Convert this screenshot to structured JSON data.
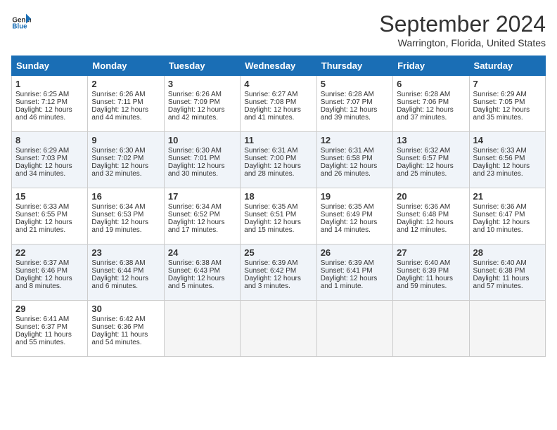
{
  "header": {
    "logo_line1": "General",
    "logo_line2": "Blue",
    "month": "September 2024",
    "location": "Warrington, Florida, United States"
  },
  "days_of_week": [
    "Sunday",
    "Monday",
    "Tuesday",
    "Wednesday",
    "Thursday",
    "Friday",
    "Saturday"
  ],
  "weeks": [
    [
      {
        "num": "1",
        "sunrise": "6:25 AM",
        "sunset": "7:12 PM",
        "daylight": "12 hours and 46 minutes."
      },
      {
        "num": "2",
        "sunrise": "6:26 AM",
        "sunset": "7:11 PM",
        "daylight": "12 hours and 44 minutes."
      },
      {
        "num": "3",
        "sunrise": "6:26 AM",
        "sunset": "7:09 PM",
        "daylight": "12 hours and 42 minutes."
      },
      {
        "num": "4",
        "sunrise": "6:27 AM",
        "sunset": "7:08 PM",
        "daylight": "12 hours and 41 minutes."
      },
      {
        "num": "5",
        "sunrise": "6:28 AM",
        "sunset": "7:07 PM",
        "daylight": "12 hours and 39 minutes."
      },
      {
        "num": "6",
        "sunrise": "6:28 AM",
        "sunset": "7:06 PM",
        "daylight": "12 hours and 37 minutes."
      },
      {
        "num": "7",
        "sunrise": "6:29 AM",
        "sunset": "7:05 PM",
        "daylight": "12 hours and 35 minutes."
      }
    ],
    [
      {
        "num": "8",
        "sunrise": "6:29 AM",
        "sunset": "7:03 PM",
        "daylight": "12 hours and 34 minutes."
      },
      {
        "num": "9",
        "sunrise": "6:30 AM",
        "sunset": "7:02 PM",
        "daylight": "12 hours and 32 minutes."
      },
      {
        "num": "10",
        "sunrise": "6:30 AM",
        "sunset": "7:01 PM",
        "daylight": "12 hours and 30 minutes."
      },
      {
        "num": "11",
        "sunrise": "6:31 AM",
        "sunset": "7:00 PM",
        "daylight": "12 hours and 28 minutes."
      },
      {
        "num": "12",
        "sunrise": "6:31 AM",
        "sunset": "6:58 PM",
        "daylight": "12 hours and 26 minutes."
      },
      {
        "num": "13",
        "sunrise": "6:32 AM",
        "sunset": "6:57 PM",
        "daylight": "12 hours and 25 minutes."
      },
      {
        "num": "14",
        "sunrise": "6:33 AM",
        "sunset": "6:56 PM",
        "daylight": "12 hours and 23 minutes."
      }
    ],
    [
      {
        "num": "15",
        "sunrise": "6:33 AM",
        "sunset": "6:55 PM",
        "daylight": "12 hours and 21 minutes."
      },
      {
        "num": "16",
        "sunrise": "6:34 AM",
        "sunset": "6:53 PM",
        "daylight": "12 hours and 19 minutes."
      },
      {
        "num": "17",
        "sunrise": "6:34 AM",
        "sunset": "6:52 PM",
        "daylight": "12 hours and 17 minutes."
      },
      {
        "num": "18",
        "sunrise": "6:35 AM",
        "sunset": "6:51 PM",
        "daylight": "12 hours and 15 minutes."
      },
      {
        "num": "19",
        "sunrise": "6:35 AM",
        "sunset": "6:49 PM",
        "daylight": "12 hours and 14 minutes."
      },
      {
        "num": "20",
        "sunrise": "6:36 AM",
        "sunset": "6:48 PM",
        "daylight": "12 hours and 12 minutes."
      },
      {
        "num": "21",
        "sunrise": "6:36 AM",
        "sunset": "6:47 PM",
        "daylight": "12 hours and 10 minutes."
      }
    ],
    [
      {
        "num": "22",
        "sunrise": "6:37 AM",
        "sunset": "6:46 PM",
        "daylight": "12 hours and 8 minutes."
      },
      {
        "num": "23",
        "sunrise": "6:38 AM",
        "sunset": "6:44 PM",
        "daylight": "12 hours and 6 minutes."
      },
      {
        "num": "24",
        "sunrise": "6:38 AM",
        "sunset": "6:43 PM",
        "daylight": "12 hours and 5 minutes."
      },
      {
        "num": "25",
        "sunrise": "6:39 AM",
        "sunset": "6:42 PM",
        "daylight": "12 hours and 3 minutes."
      },
      {
        "num": "26",
        "sunrise": "6:39 AM",
        "sunset": "6:41 PM",
        "daylight": "12 hours and 1 minute."
      },
      {
        "num": "27",
        "sunrise": "6:40 AM",
        "sunset": "6:39 PM",
        "daylight": "11 hours and 59 minutes."
      },
      {
        "num": "28",
        "sunrise": "6:40 AM",
        "sunset": "6:38 PM",
        "daylight": "11 hours and 57 minutes."
      }
    ],
    [
      {
        "num": "29",
        "sunrise": "6:41 AM",
        "sunset": "6:37 PM",
        "daylight": "11 hours and 55 minutes."
      },
      {
        "num": "30",
        "sunrise": "6:42 AM",
        "sunset": "6:36 PM",
        "daylight": "11 hours and 54 minutes."
      },
      null,
      null,
      null,
      null,
      null
    ]
  ]
}
